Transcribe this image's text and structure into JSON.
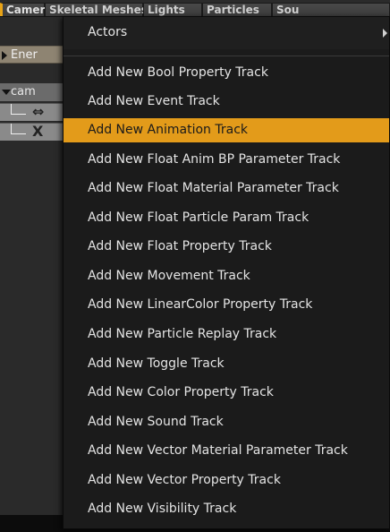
{
  "tabs": [
    {
      "label": "Cameras",
      "active": true
    },
    {
      "label": "Skeletal Meshes",
      "active": false
    },
    {
      "label": "Lights",
      "active": false
    },
    {
      "label": "Particles",
      "active": false
    },
    {
      "label": "Sou",
      "active": false
    }
  ],
  "tree": {
    "group_label": "Ener",
    "actor_label": "cam",
    "child1_icon": "⇔",
    "child2_icon": "X"
  },
  "menu": {
    "header_label": "Actors",
    "highlighted_index": 2,
    "items": [
      "Add New Bool Property Track",
      "Add New Event Track",
      "Add New Animation Track",
      "Add New Float Anim BP Parameter Track",
      "Add New Float Material Parameter Track",
      "Add New Float Particle Param Track",
      "Add New Float Property Track",
      "Add New Movement Track",
      "Add New LinearColor Property Track",
      "Add New Particle Replay Track",
      "Add New Toggle Track",
      "Add New Color Property Track",
      "Add New Sound Track",
      "Add New Vector Material Parameter Track",
      "Add New Vector Property Track",
      "Add New Visibility Track"
    ]
  },
  "colors": {
    "highlight": "#e39b1a",
    "active_tab_marker": "#e8a317",
    "menu_bg": "#1b1b1b"
  }
}
